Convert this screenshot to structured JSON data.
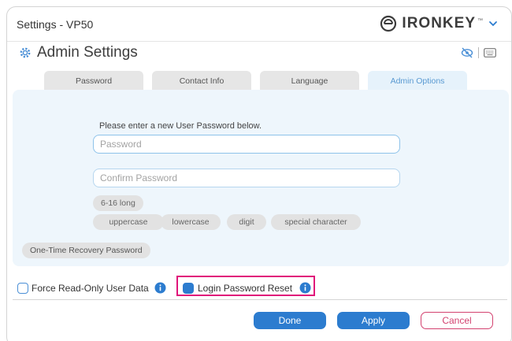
{
  "window": {
    "title": "Settings - VP50",
    "brand": "IRONKEY",
    "brand_tm": "™"
  },
  "section": {
    "title": "Admin Settings"
  },
  "tabs": [
    {
      "label": "Password",
      "active": false
    },
    {
      "label": "Contact Info",
      "active": false
    },
    {
      "label": "Language",
      "active": false
    },
    {
      "label": "Admin Options",
      "active": true
    }
  ],
  "form": {
    "prompt": "Please enter a new User Password below.",
    "password_placeholder": "Password",
    "confirm_placeholder": "Confirm Password",
    "password_value": "",
    "confirm_value": ""
  },
  "requirements": {
    "length": "6-16 long",
    "uppercase": "uppercase",
    "lowercase": "lowercase",
    "digit": "digit",
    "special": "special character"
  },
  "recovery_button": "One-Time Recovery Password",
  "options": {
    "force_readonly": {
      "label": "Force Read-Only User Data",
      "checked": false
    },
    "login_reset": {
      "label": "Login Password Reset",
      "checked": true
    }
  },
  "buttons": {
    "done": "Done",
    "apply": "Apply",
    "cancel": "Cancel"
  },
  "colors": {
    "accent": "#2c7ccf",
    "highlight": "#e0157a",
    "cancel": "#d3416f"
  }
}
